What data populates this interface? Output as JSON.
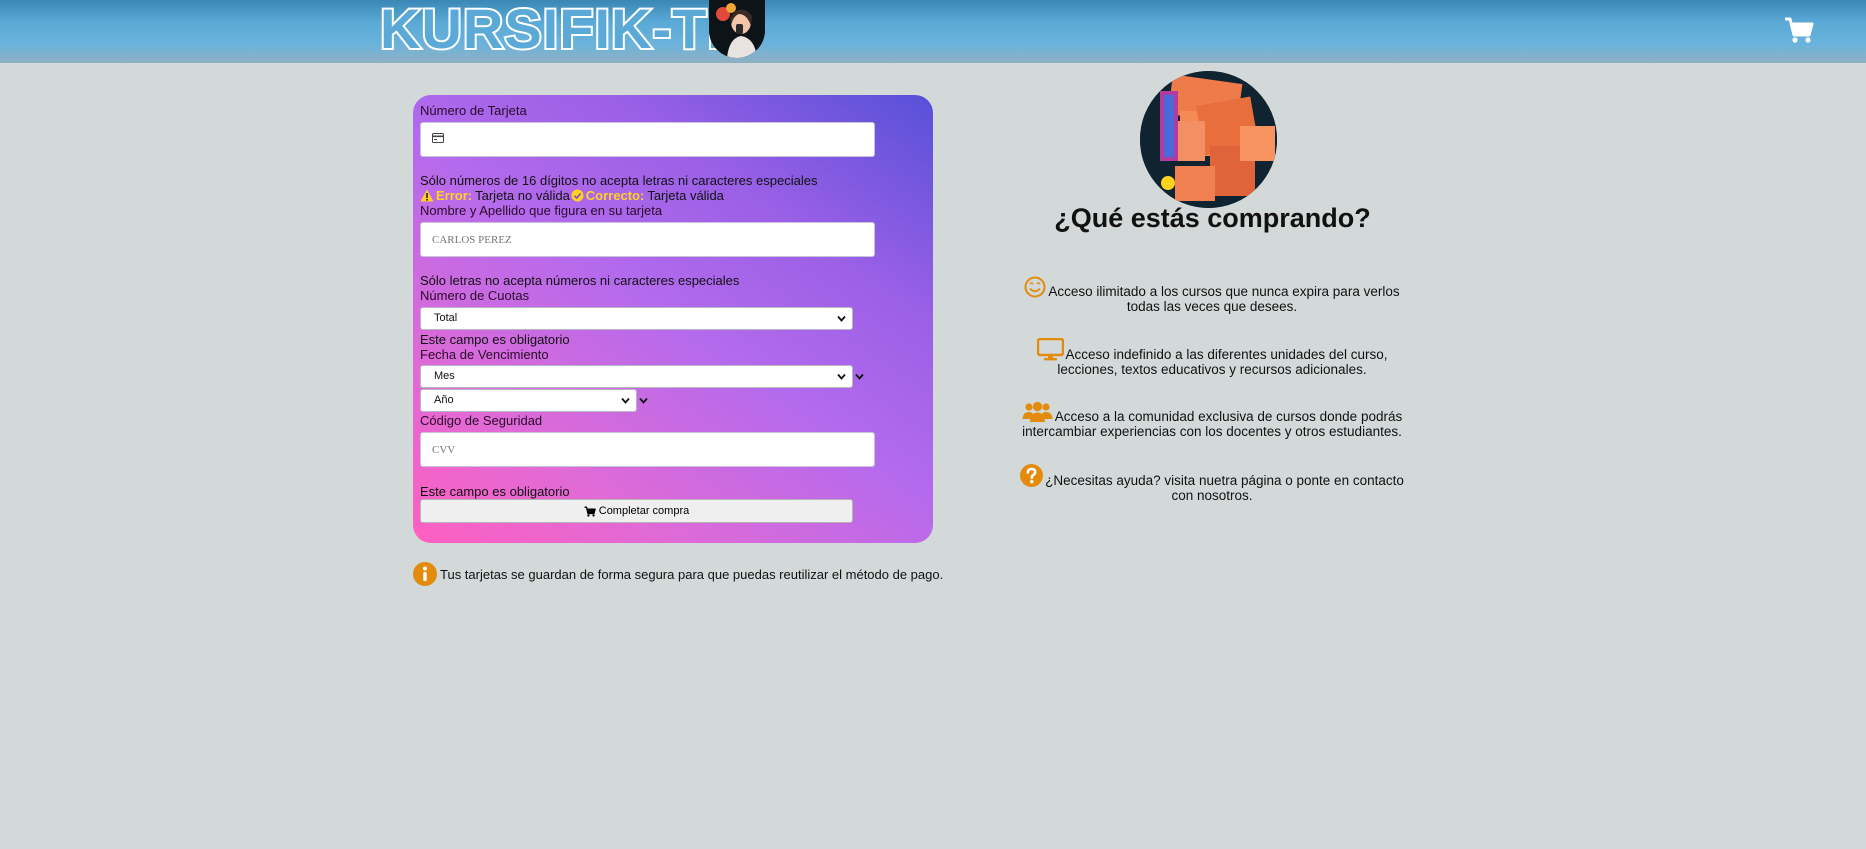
{
  "header": {
    "logo_text": "KURSIFIK-TE",
    "cart_icon": "cart-icon"
  },
  "form": {
    "card_number": {
      "label": "Número de Tarjeta",
      "value": "",
      "placeholder": "",
      "hint": "Sólo números de 16 dígitos no acepta letras ni caracteres especiales"
    },
    "validation": {
      "error_label": "Error:",
      "error_text": "Tarjeta no válida",
      "ok_label": "Correcto:",
      "ok_text": "Tarjeta válida"
    },
    "name": {
      "label": "Nombre y Apellido que figura en su tarjeta",
      "value": "",
      "placeholder": "CARLOS PEREZ",
      "hint": "Sólo letras no acepta números ni caracteres especiales"
    },
    "installments": {
      "label": "Número de Cuotas",
      "selected": "Total",
      "hint": "Este campo es obligatorio"
    },
    "expiry": {
      "label": "Fecha de Vencimiento",
      "month_selected": "Mes",
      "year_selected": "Año"
    },
    "cvv": {
      "label": "Código de Seguridad",
      "value": "",
      "placeholder": "CVV",
      "hint": "Este campo es obligatorio"
    },
    "submit_label": "Completar compra"
  },
  "note": "Tus tarjetas se guardan de forma segura para que puedas reutilizar el método de pago.",
  "sidebar": {
    "title": "¿Qué estás comprando?",
    "features": [
      {
        "icon": "smile-icon",
        "text": "Acceso ilimitado a los cursos que nunca expira para verlos todas las veces que desees."
      },
      {
        "icon": "monitor-icon",
        "text": "Acceso indefinido a las diferentes unidades del curso, lecciones, textos educativos y recursos adicionales."
      },
      {
        "icon": "users-icon",
        "text": "Acceso a la comunidad exclusiva de cursos donde podrás intercambiar experiencias con los docentes y otros estudiantes."
      },
      {
        "icon": "question-icon",
        "text": "¿Necesitas ayuda? visita nuetra página o ponte en contacto con nosotros."
      }
    ]
  },
  "colors": {
    "accent": "#e38b0c",
    "validation": "#ffd21f",
    "page_bg": "#d3d9d9"
  }
}
